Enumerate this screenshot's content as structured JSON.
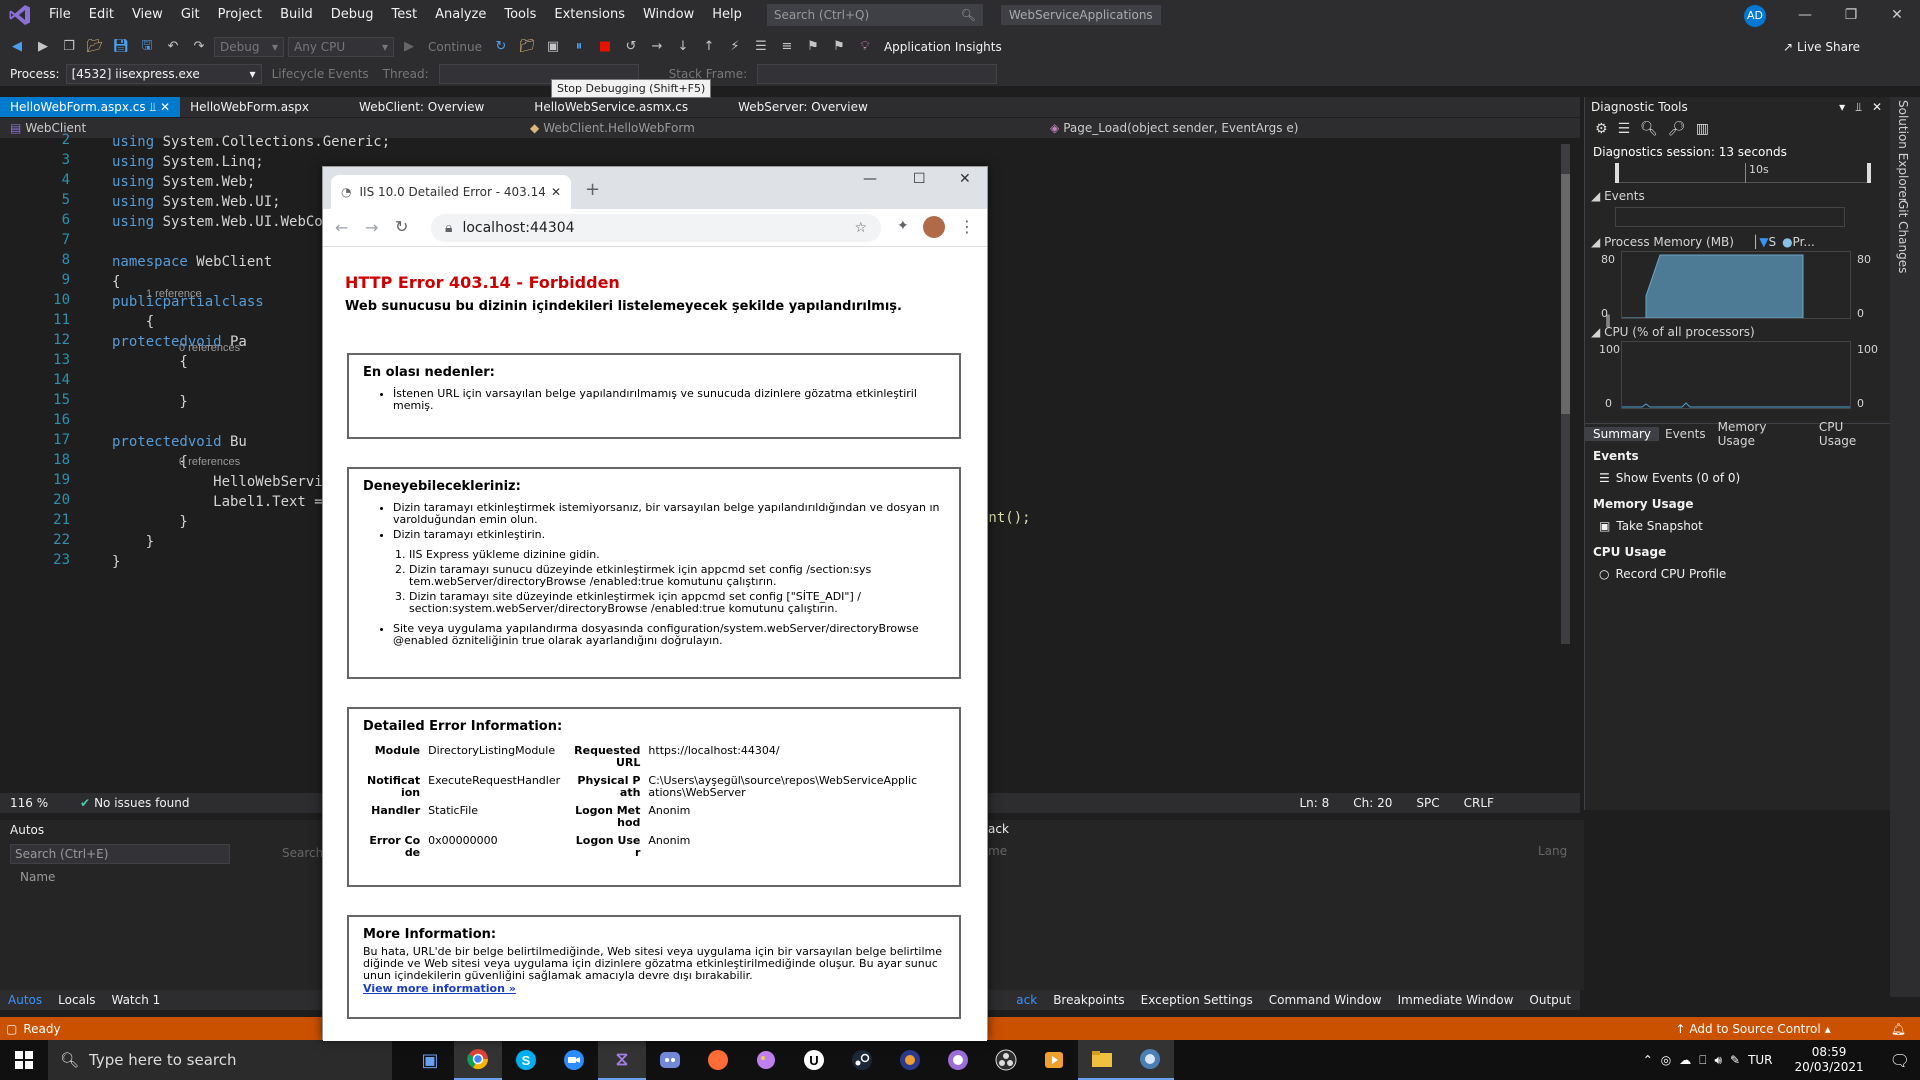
{
  "menu": {
    "items": [
      "File",
      "Edit",
      "View",
      "Git",
      "Project",
      "Build",
      "Debug",
      "Test",
      "Analyze",
      "Tools",
      "Extensions",
      "Window",
      "Help"
    ],
    "search_placeholder": "Search (Ctrl+Q)",
    "solution_name": "WebServiceApplications",
    "avatar_initials": "AD"
  },
  "toolbar": {
    "config": "Debug",
    "platform": "Any CPU",
    "continue_label": "Continue",
    "app_insights": "Application Insights",
    "live_share": "Live Share",
    "process_label": "Process:",
    "process_value": "[4532] iisexpress.exe",
    "lifecycle_label": "Lifecycle Events",
    "thread_label": "Thread:",
    "stack_frame_label": "Stack Frame:",
    "tooltip": "Stop Debugging (Shift+F5)"
  },
  "doc_tabs": [
    "HelloWebForm.aspx.cs",
    "HelloWebForm.aspx",
    "WebClient: Overview",
    "HelloWebService.asmx.cs",
    "WebServer: Overview"
  ],
  "nav": {
    "project": "WebClient",
    "class": "WebClient.HelloWebForm",
    "member": "Page_Load(object sender, EventArgs e)"
  },
  "code": {
    "lines": [
      {
        "n": "2",
        "text": "using System.Collections.Generic;"
      },
      {
        "n": "3",
        "text": "using System.Linq;"
      },
      {
        "n": "4",
        "text": "using System.Web;"
      },
      {
        "n": "5",
        "text": "using System.Web.UI;"
      },
      {
        "n": "6",
        "text": "using System.Web.UI.WebCo"
      },
      {
        "n": "7",
        "text": ""
      },
      {
        "n": "8",
        "text": "namespace WebClient"
      },
      {
        "n": "9",
        "text": "{"
      },
      {
        "n": "10",
        "text": "    public partial class"
      },
      {
        "n": "11",
        "text": "    {"
      },
      {
        "n": "12",
        "text": "        protected void Pa"
      },
      {
        "n": "13",
        "text": "        {"
      },
      {
        "n": "14",
        "text": ""
      },
      {
        "n": "15",
        "text": "        }"
      },
      {
        "n": "16",
        "text": ""
      },
      {
        "n": "17",
        "text": "        protected void Bu"
      },
      {
        "n": "18",
        "text": "        {"
      },
      {
        "n": "19",
        "text": "            HelloWebServi"
      },
      {
        "n": "20",
        "text": "            Label1.Text ="
      },
      {
        "n": "21",
        "text": "        }"
      },
      {
        "n": "22",
        "text": "    }"
      },
      {
        "n": "23",
        "text": "}"
      }
    ],
    "ref1": "1 reference",
    "ref0a": "0 references",
    "ref0b": "0 references",
    "tail19": "ent();"
  },
  "editor_status": {
    "zoom": "116 %",
    "issues": "No issues found",
    "ln": "Ln: 8",
    "ch": "Ch: 20",
    "spc": "SPC",
    "crlf": "CRLF"
  },
  "autos": {
    "title": "Autos",
    "search_placeholder": "Search (Ctrl+E)",
    "search2": "Search",
    "col_name": "Name",
    "right_hint1": "ack",
    "right_hint2": "me",
    "right_hint3": "Lang"
  },
  "bottom_tabs_left": [
    "Autos",
    "Locals",
    "Watch 1"
  ],
  "bottom_tabs_right": [
    "ack",
    "Breakpoints",
    "Exception Settings",
    "Command Window",
    "Immediate Window",
    "Output"
  ],
  "statusbar": {
    "ready": "Ready",
    "source_control": "Add to Source Control"
  },
  "diag": {
    "title": "Diagnostic Tools",
    "session": "Diagnostics session: 13 seconds",
    "timeline_label": "10s",
    "events_header": "Events",
    "memory_header": "Process Memory (MB)",
    "memory_legend1": "S",
    "memory_legend2": "Pr...",
    "mem_max": "80",
    "mem_min": "0",
    "cpu_header": "CPU (% of all processors)",
    "cpu_max": "100",
    "cpu_min": "0",
    "tabs": [
      "Summary",
      "Events",
      "Memory Usage",
      "CPU Usage"
    ],
    "sec_events": "Events",
    "show_events": "Show Events (0 of 0)",
    "sec_memory": "Memory Usage",
    "take_snapshot": "Take Snapshot",
    "sec_cpu": "CPU Usage",
    "record_cpu": "Record CPU Profile",
    "memory_fill": 0.75,
    "memory_level": 0.95
  },
  "side_labels": [
    "Solution Explorer",
    "Git Changes"
  ],
  "browser": {
    "tab_title": "IIS 10.0 Detailed Error - 403.14 - I",
    "url": "localhost:44304",
    "error_title": "HTTP Error 403.14 - Forbidden",
    "error_subtitle": "Web sunucusu bu dizinin içindekileri listelemeyecek şekilde yapılandırılmış.",
    "cause_title": "En olası nedenler:",
    "cause_item": "İstenen URL için varsayılan belge yapılandırılmamış ve sunucuda dizinlere gözatma etkinleştiril memiş.",
    "try_title": "Deneyebilecekleriniz:",
    "try_items": [
      "Dizin taramayı etkinleştirmek istemiyorsanız, bir varsayılan belge yapılandırıldığından ve dosyan ın varolduğundan emin olun.",
      "Dizin taramayı etkinleştirin."
    ],
    "try_steps": [
      "IIS Express yükleme dizinine gidin.",
      "Dizin taramayı sunucu düzeyinde etkinleştirmek için appcmd set config /section:sys tem.webServer/directoryBrowse /enabled:true komutunu çalıştırın.",
      "Dizin taramayı site düzeyinde etkinleştirmek için appcmd set config [\"SİTE_ADI\"] / section:system.webServer/directoryBrowse /enabled:true komutunu çalıştırın."
    ],
    "try_last": "Site veya uygulama yapılandırma dosyasında configuration/system.webServer/directoryBrowse @enabled özniteliğinin true olarak ayarlandığını doğrulayın.",
    "detail_title": "Detailed Error Information:",
    "detail": {
      "module_k": "Module",
      "module_v": "DirectoryListingModule",
      "notif_k": "Notificat ion",
      "notif_v": "ExecuteRequestHandler",
      "handler_k": "Handler",
      "handler_v": "StaticFile",
      "code_k": "Error Co de",
      "code_v": "0x00000000",
      "url_k": "Requested URL",
      "url_v": "https://localhost:44304/",
      "path_k": "Physical P ath",
      "path_v": "C:\\Users\\ayşegül\\source\\repos\\WebServiceApplic ations\\WebServer",
      "logon_k": "Logon Met hod",
      "logon_v": "Anonim",
      "user_k": "Logon Use r",
      "user_v": "Anonim"
    },
    "more_title": "More Information:",
    "more_text": "Bu hata, URL'de bir belge belirtilmediğinde, Web sitesi veya uygulama için bir varsayılan belge belirtilme diğinde ve Web sitesi veya uygulama için dizinlere gözatma etkinleştirilmediğinde oluşur. Bu ayar sunuc unun içindekilerin güvenliğini sağlamak amacıyla devre dışı bırakabilir.",
    "more_link": "View more information »"
  },
  "taskbar": {
    "search_placeholder": "Type here to search",
    "lang": "TUR",
    "time": "08:59",
    "date": "20/03/2021"
  }
}
